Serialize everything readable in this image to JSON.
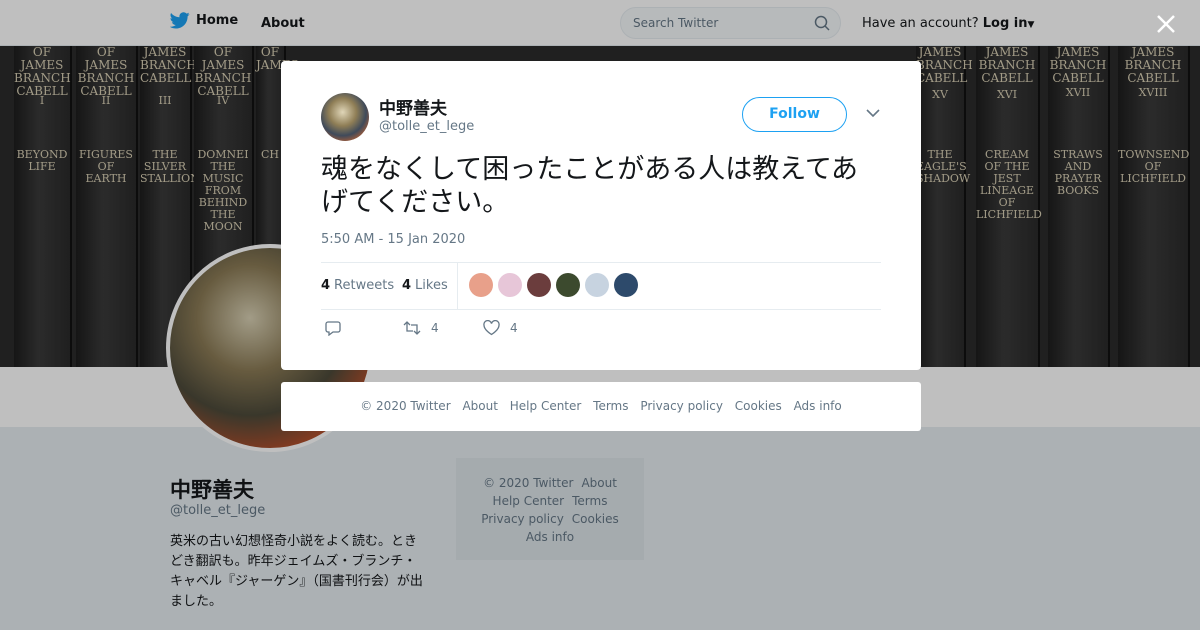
{
  "nav": {
    "home_label": "Home",
    "about_label": "About",
    "search_placeholder": "Search Twitter",
    "account_prompt": "Have an account?",
    "login_label": "Log in"
  },
  "banner": {
    "books": [
      {
        "title": "OF JAMES BRANCH CABELL",
        "num": "I",
        "name": "BEYOND LIFE"
      },
      {
        "title": "OF JAMES BRANCH CABELL",
        "num": "II",
        "name": "FIGURES OF EARTH"
      },
      {
        "title": "JAMES BRANCH CABELL",
        "num": "III",
        "name": "THE SILVER STALLION"
      },
      {
        "title": "OF JAMES BRANCH CABELL",
        "num": "IV",
        "name": "DOMNEI THE MUSIC FROM BEHIND THE MOON"
      },
      {
        "title": "OF JAMES",
        "num": "",
        "name": "CH"
      },
      {
        "title": "JAMES BRANCH CABELL",
        "num": "XV",
        "name": "THE EAGLE'S SHADOW"
      },
      {
        "title": "JAMES BRANCH CABELL",
        "num": "XVI",
        "name": "CREAM OF THE JEST LINEAGE OF LICHFIELD"
      },
      {
        "title": "JAMES BRANCH CABELL",
        "num": "XVII",
        "name": "STRAWS AND PRAYER BOOKS"
      },
      {
        "title": "JAMES BRANCH CABELL",
        "num": "XVIII",
        "name": "TOWNSEND OF LICHFIELD"
      }
    ]
  },
  "profile": {
    "name": "中野善夫",
    "handle": "@tolle_et_lege",
    "bio": "英米の古い幻想怪奇小説をよく読む。ときどき翻訳も。昨年ジェイムズ・ブランチ・キャベル『ジャーゲン』（国書刊行会）が出ました。"
  },
  "side_footer": [
    "© 2020 Twitter",
    "About",
    "Help Center",
    "Terms",
    "Privacy policy",
    "Cookies",
    "Ads info"
  ],
  "tweet": {
    "name": "中野善夫",
    "handle": "@tolle_et_lege",
    "follow_label": "Follow",
    "text": "魂をなくして困ったことがある人は教えてあげてください。",
    "timestamp": "5:50 AM - 15 Jan 2020",
    "retweets_count": "4",
    "retweets_label": "Retweets",
    "likes_count": "4",
    "likes_label": "Likes",
    "reply_count": "",
    "retweet_action_count": "4",
    "like_action_count": "4",
    "liker_colors": [
      "#e8a08a",
      "#e7c6d8",
      "#6b3d3d",
      "#3c4a2e",
      "#c7d3e0",
      "#2d4a6b"
    ]
  },
  "modal_footer": [
    "© 2020 Twitter",
    "About",
    "Help Center",
    "Terms",
    "Privacy policy",
    "Cookies",
    "Ads info"
  ],
  "colors": {
    "accent": "#1da1f2",
    "text": "#14171a",
    "muted": "#657786"
  }
}
